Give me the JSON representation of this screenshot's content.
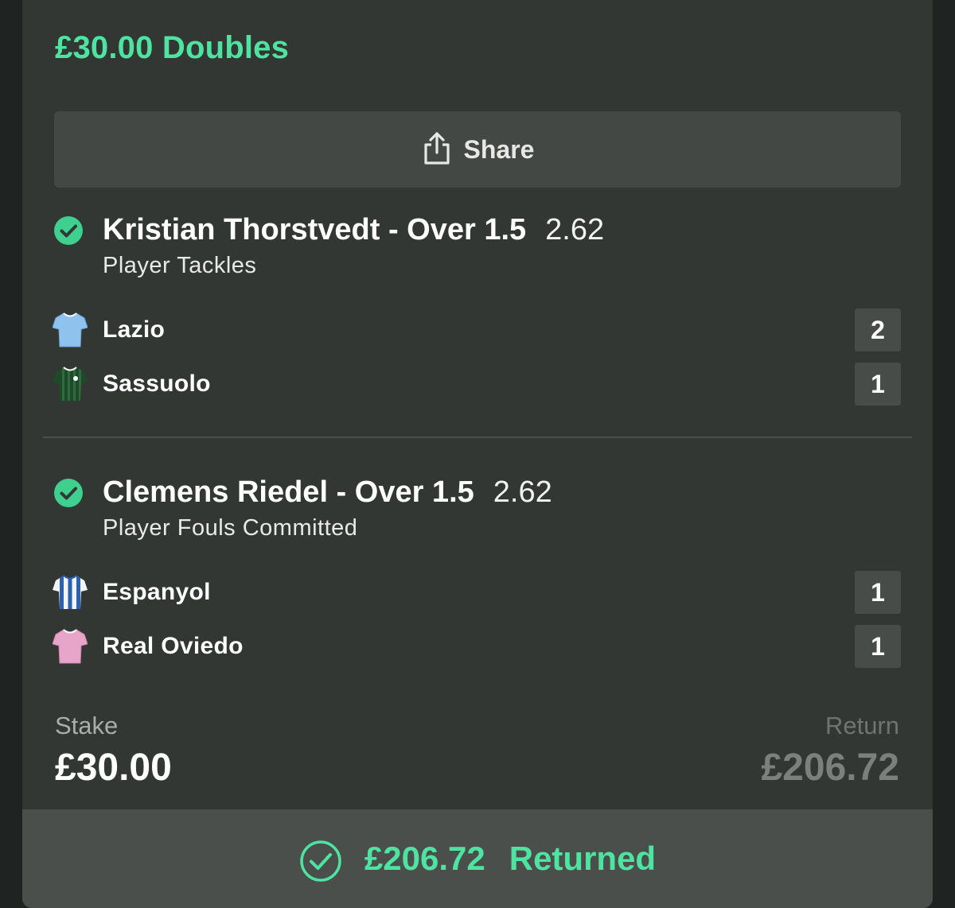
{
  "bet": {
    "title": "£30.00 Doubles",
    "share_label": "Share"
  },
  "legs": [
    {
      "selection": "Kristian Thorstvedt - Over 1.5",
      "odds": "2.62",
      "market": "Player Tackles",
      "result": "won",
      "teams": [
        {
          "name": "Lazio",
          "stat": "2",
          "shirt": "light-blue-shirt"
        },
        {
          "name": "Sassuolo",
          "stat": "1",
          "shirt": "green-striped-shirt"
        }
      ]
    },
    {
      "selection": "Clemens Riedel - Over 1.5",
      "odds": "2.62",
      "market": "Player Fouls Committed",
      "result": "won",
      "teams": [
        {
          "name": "Espanyol",
          "stat": "1",
          "shirt": "blue-white-striped-shirt"
        },
        {
          "name": "Real Oviedo",
          "stat": "1",
          "shirt": "pink-shirt"
        }
      ]
    }
  ],
  "summary": {
    "stake_label": "Stake",
    "stake_value": "£30.00",
    "return_label": "Return",
    "return_value": "£206.72"
  },
  "footer": {
    "amount": "£206.72",
    "status": "Returned"
  },
  "colors": {
    "accent": "#4fe3a1",
    "win_check": "#3fcf8e",
    "card_bg": "#323734"
  }
}
